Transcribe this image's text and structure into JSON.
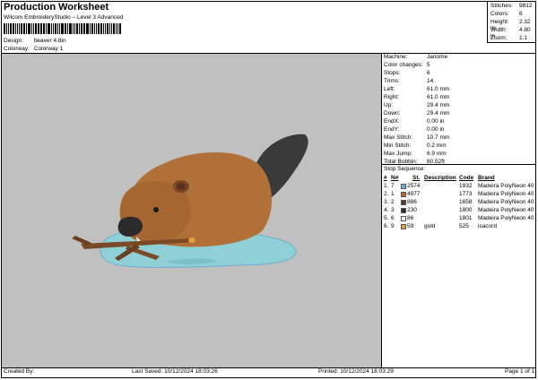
{
  "header": {
    "title": "Production Worksheet",
    "subtitle": "Wilcom EmbroideryStudio – Level 3 Advanced",
    "design_label": "Design:",
    "design_value": "beaver 4.8in",
    "colorway_label": "Colorway:",
    "colorway_value": "Colorway 1"
  },
  "stats": [
    {
      "label": "Stitches:",
      "value": "9812"
    },
    {
      "label": "Colors:",
      "value": "6"
    },
    {
      "label": "Height:",
      "value": "2.32 in"
    },
    {
      "label": "Width:",
      "value": "4.80 in"
    },
    {
      "label": "Zoom:",
      "value": "1:1"
    }
  ],
  "info": [
    {
      "label": "Machine:",
      "value": "Janome"
    },
    {
      "label": "Color changes:",
      "value": "5"
    },
    {
      "label": "Stops:",
      "value": "6"
    },
    {
      "label": "Trims:",
      "value": "14"
    },
    {
      "label": "Left:",
      "value": "61.0 mm"
    },
    {
      "label": "Right:",
      "value": "61.0 mm"
    },
    {
      "label": "Up:",
      "value": "29.4 mm"
    },
    {
      "label": "Down:",
      "value": "29.4 mm"
    },
    {
      "label": "EndX:",
      "value": "0.00 in"
    },
    {
      "label": "EndY:",
      "value": "0.00 in"
    },
    {
      "label": "Max Stitch:",
      "value": "10.7 mm"
    },
    {
      "label": "Min Stitch:",
      "value": "0.2 mm"
    },
    {
      "label": "Max Jump:",
      "value": "6.9 mm"
    },
    {
      "label": "Total Bobbin:",
      "value": "80.52ft"
    }
  ],
  "stop_sequence": {
    "title": "Stop Sequence:",
    "headers": [
      "#",
      "N#",
      "St.",
      "Description",
      "Code",
      "Brand"
    ],
    "rows": [
      {
        "num": "1.",
        "n": "7",
        "code_id": "2574",
        "stitches": "1932",
        "brand": "Madeira PolyNeon 40",
        "color": "#6aaed6"
      },
      {
        "num": "2.",
        "n": "1",
        "code_id": "4977",
        "stitches": "1773",
        "brand": "Madeira PolyNeon 40",
        "color": "#b5652f"
      },
      {
        "num": "3.",
        "n": "2",
        "code_id": "886",
        "stitches": "1658",
        "brand": "Madeira PolyNeon 40",
        "color": "#5a3a2a"
      },
      {
        "num": "4.",
        "n": "3",
        "code_id": "230",
        "stitches": "1800",
        "brand": "Madeira PolyNeon 40",
        "color": "#2b2b2b"
      },
      {
        "num": "5.",
        "n": "6",
        "code_id": "86",
        "stitches": "1801",
        "brand": "Madeira PolyNeon 40",
        "color": "#f2f2f2"
      },
      {
        "num": "6.",
        "n": "9",
        "code_id": "59",
        "desc": "gold",
        "stitches": "525",
        "brand": "isacord",
        "color": "#e0a040"
      }
    ]
  },
  "footer": {
    "created_by": "Created By:",
    "last_saved": "Last Saved: 10/12/2024 18:03:26",
    "printed": "Printed: 10/12/2024 18:03:29",
    "page": "Page 1 of 1"
  }
}
